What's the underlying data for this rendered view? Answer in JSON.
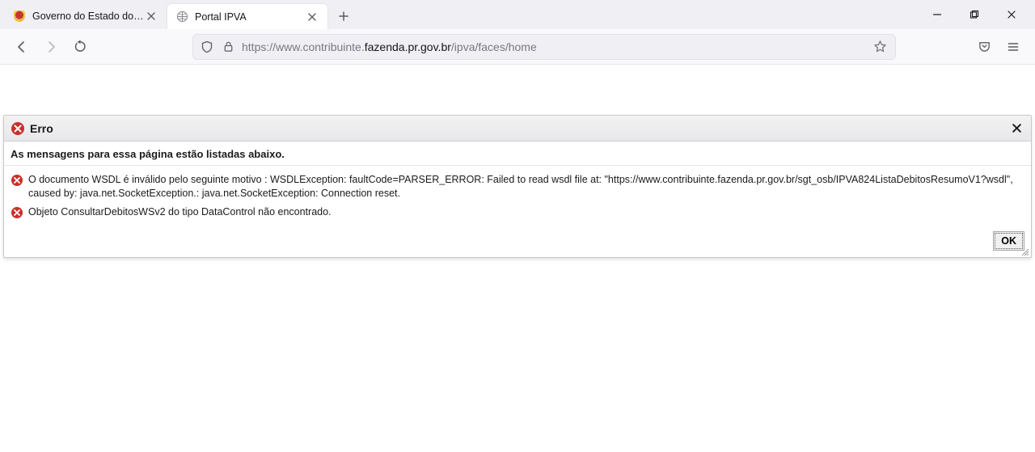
{
  "tabs": [
    {
      "title": "Governo do Estado do Paraná",
      "active": false
    },
    {
      "title": "Portal IPVA",
      "active": true
    }
  ],
  "url": {
    "prefix": "https://www.contribuinte.",
    "bold": "fazenda.pr.gov.br",
    "suffix": "/ipva/faces/home"
  },
  "error": {
    "title": "Erro",
    "subtitle": "As mensagens para essa página estão listadas abaixo.",
    "messages": [
      "O documento WSDL é inválido pelo seguinte motivo : WSDLException: faultCode=PARSER_ERROR: Failed to read wsdl file at: \"https://www.contribuinte.fazenda.pr.gov.br/sgt_osb/IPVA824ListaDebitosResumoV1?wsdl\", caused by: java.net.SocketException.: java.net.SocketException: Connection reset.",
      "Objeto ConsultarDebitosWSv2 do tipo DataControl não encontrado."
    ],
    "ok": "OK"
  }
}
